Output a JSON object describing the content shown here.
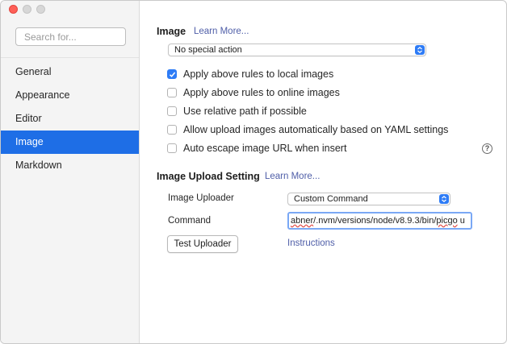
{
  "window": {
    "controls": [
      "close",
      "minimize",
      "zoom"
    ]
  },
  "search": {
    "placeholder": "Search for..."
  },
  "sidebar": {
    "items": [
      {
        "label": "General",
        "active": false
      },
      {
        "label": "Appearance",
        "active": false
      },
      {
        "label": "Editor",
        "active": false
      },
      {
        "label": "Image",
        "active": true
      },
      {
        "label": "Markdown",
        "active": false
      }
    ]
  },
  "image_section": {
    "title": "Image",
    "learn_more": "Learn More...",
    "action_select": "No special action",
    "checkboxes": [
      {
        "label": "Apply above rules to local images",
        "checked": true
      },
      {
        "label": "Apply above rules to online images",
        "checked": false
      },
      {
        "label": "Use relative path if possible",
        "checked": false
      },
      {
        "label": "Allow upload images automatically based on YAML settings",
        "checked": false
      },
      {
        "label": "Auto escape image URL when insert",
        "checked": false
      }
    ],
    "help_icon": "?"
  },
  "upload_section": {
    "title": "Image Upload Setting",
    "learn_more": "Learn More...",
    "uploader_label": "Image Uploader",
    "uploader_value": "Custom Command",
    "command_label": "Command",
    "command_value_prefix": "abner",
    "command_value_rest": "/.nvm/versions/node/v8.9.3/bin/",
    "command_value_picgo": "picgo",
    "command_value_tail": " u",
    "test_button": "Test Uploader",
    "instructions_link": "Instructions"
  },
  "colors": {
    "accent": "#1e6ee6",
    "link": "#4f5ea8",
    "close_dot": "#fe5f57"
  },
  "icons": [
    "close-dot",
    "minimize-dot",
    "zoom-dot",
    "select-stepper-icon",
    "checkmark-icon",
    "help-icon"
  ]
}
